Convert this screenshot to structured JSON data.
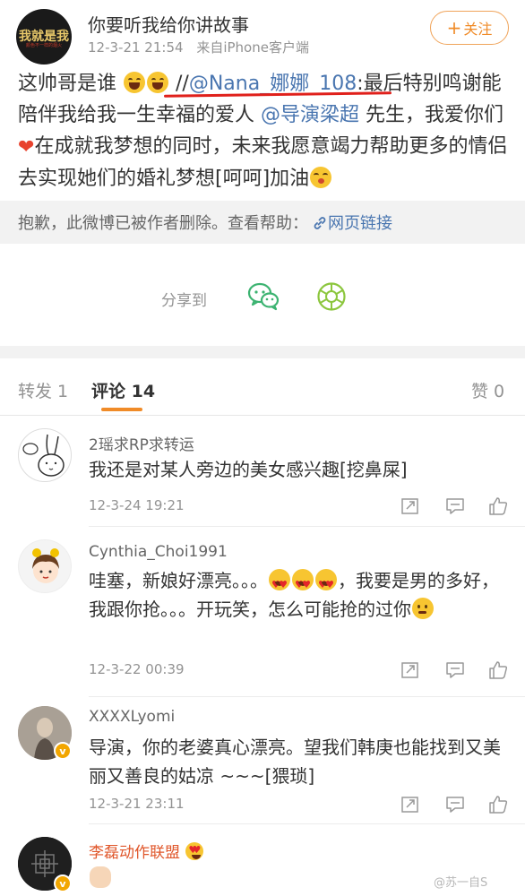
{
  "post": {
    "avatar_logo_line1": "我就是我",
    "avatar_logo_line2": "颜色不一样的烟火",
    "user_name": "你要听我给你讲故事",
    "time": "12-3-21 21:54",
    "source": "来自iPhone客户端",
    "follow_label": "关注",
    "text_part1": "这帅哥是谁",
    "text_part2": " //",
    "mention1": "@Nana_娜娜_108",
    "text_part3": ":最后特别鸣谢能陪伴我给我一生幸福的爱人 ",
    "mention2": "@导演梁超",
    "text_part4": " 先生，我爱你们",
    "text_part5": "在成就我梦想的同时，未来我愿意竭力帮助更多的情侣去实现她们的婚礼梦想[呵呵]加油",
    "deleted_notice": "抱歉，此微博已被作者删除。查看帮助：",
    "deleted_link": "网页链接",
    "share_label": "分享到"
  },
  "tabs": {
    "repost": "转发 1",
    "comments": "评论 14",
    "likes": "赞 0"
  },
  "comments": [
    {
      "name": "2瑶求RP求转运",
      "text": "我还是对某人旁边的美女感兴趣[挖鼻屎]",
      "time": "12-3-24 19:21"
    },
    {
      "name": "Cynthia_Choi1991",
      "text_a": "哇塞，新娘好漂亮。。。",
      "text_b": "，我要是男的多好，我跟你抢。。。开玩笑，怎么可能抢的过你",
      "time": "12-3-22 00:39"
    },
    {
      "name": "XXXXLyomi",
      "text": "导演，你的老婆真心漂亮。望我们韩庚也能找到又美丽又善良的姑凉 ~~~[猥琐]",
      "time": "12-3-21 23:11",
      "badge": "v"
    },
    {
      "name": "李磊动作联盟",
      "badge": "v"
    }
  ],
  "watermark": "@苏一自S",
  "colors": {
    "accent": "#f08b28",
    "link": "#4a76b0",
    "highlight_name": "#e0572b",
    "underline": "#e0201b"
  }
}
